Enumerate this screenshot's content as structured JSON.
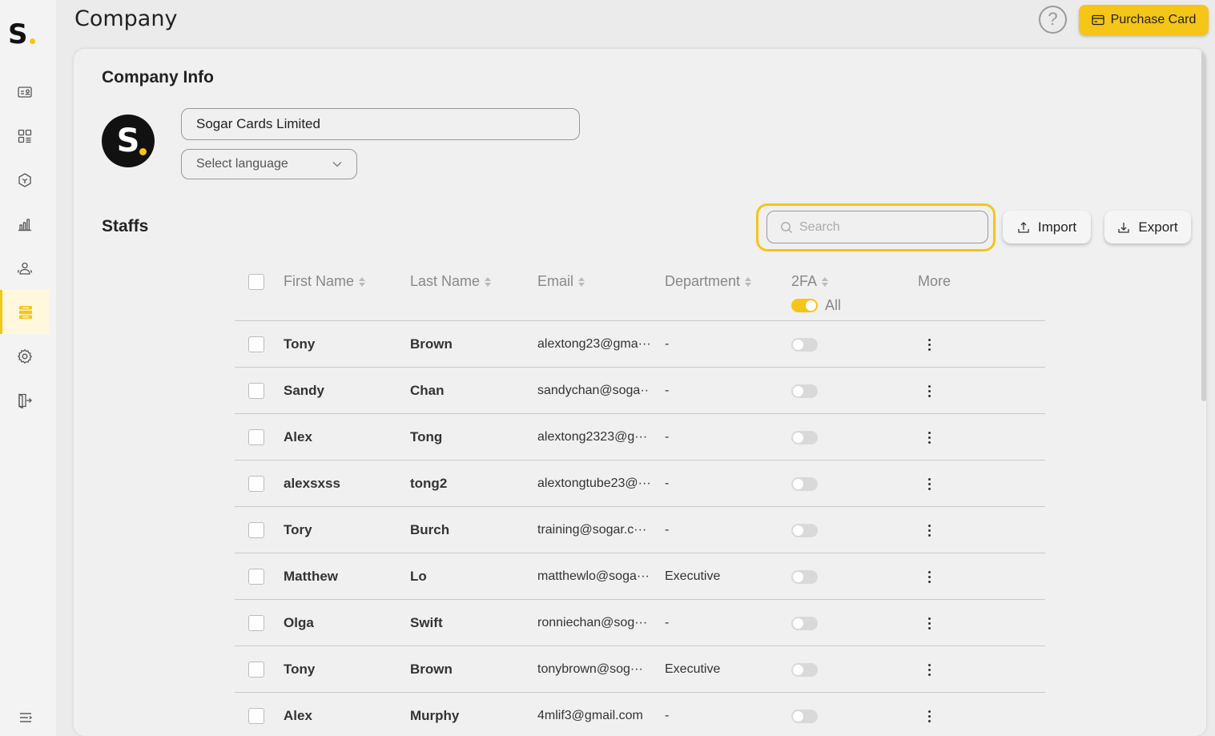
{
  "app": {
    "logo_letter": "S"
  },
  "header": {
    "title": "Company",
    "help_symbol": "?",
    "purchase_label": "Purchase Card"
  },
  "sidebar": {
    "items": [
      {
        "name": "id-card-icon"
      },
      {
        "name": "dashboard-icon"
      },
      {
        "name": "cube-icon"
      },
      {
        "name": "bar-chart-icon"
      },
      {
        "name": "users-icon"
      },
      {
        "name": "company-icon",
        "active": true
      },
      {
        "name": "settings-icon"
      },
      {
        "name": "logout-icon"
      }
    ]
  },
  "company_info": {
    "title": "Company Info",
    "name_value": "Sogar Cards Limited",
    "language_placeholder": "Select language"
  },
  "staffs": {
    "title": "Staffs",
    "search_placeholder": "Search",
    "import_label": "Import",
    "export_label": "Export",
    "columns": {
      "first_name": "First Name",
      "last_name": "Last Name",
      "email": "Email",
      "department": "Department",
      "twofa": "2FA",
      "more": "More"
    },
    "twofa_all_label": "All",
    "rows": [
      {
        "first": "Tony",
        "last": "Brown",
        "email": "alextong23@gma···",
        "dept": "-",
        "twofa": false
      },
      {
        "first": "Sandy",
        "last": "Chan",
        "email": "sandychan@soga···",
        "dept": "-",
        "twofa": false
      },
      {
        "first": "Alex",
        "last": "Tong",
        "email": "alextong2323@g···",
        "dept": "-",
        "twofa": false
      },
      {
        "first": "alexsxss",
        "last": "tong2",
        "email": "alextongtube23@···",
        "dept": "-",
        "twofa": false
      },
      {
        "first": "Tory",
        "last": "Burch",
        "email": "training@sogar.c···",
        "dept": "-",
        "twofa": false
      },
      {
        "first": "Matthew",
        "last": "Lo",
        "email": "matthewlo@soga···",
        "dept": "Executive",
        "twofa": false
      },
      {
        "first": "Olga",
        "last": "Swift",
        "email": "ronniechan@sog···",
        "dept": "-",
        "twofa": false
      },
      {
        "first": "Tony",
        "last": "Brown",
        "email": "tonybrown@sog···",
        "dept": "Executive",
        "twofa": false
      },
      {
        "first": "Alex",
        "last": "Murphy",
        "email": "4mlif3@gmail.com",
        "dept": "-",
        "twofa": false
      }
    ]
  },
  "colors": {
    "accent": "#f5c518",
    "background": "#ebebec",
    "card": "#f0f0f1"
  }
}
